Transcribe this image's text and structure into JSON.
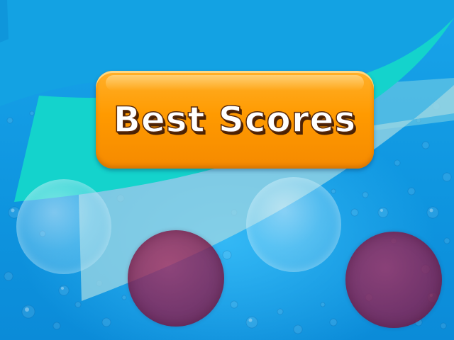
{
  "screen": {
    "background_color": "#1299e3",
    "accent_color": "#ff9a00"
  },
  "best_scores_button": {
    "label": "Best Scores",
    "icon": null
  },
  "bubbles": [
    {
      "kind": "light",
      "color": "#a8dff5"
    },
    {
      "kind": "dark",
      "color": "#8e1e55"
    },
    {
      "kind": "light",
      "color": "#a8dff5"
    },
    {
      "kind": "dark",
      "color": "#8e1e55"
    }
  ],
  "decor": {
    "sheet_colors": [
      "#15a3e4",
      "#14d6d0",
      "#8fd8e6"
    ]
  }
}
